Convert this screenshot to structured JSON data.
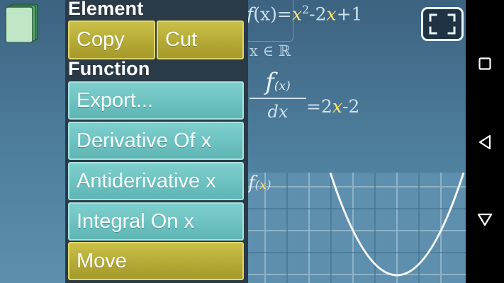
{
  "menu": {
    "element_header": "Element",
    "copy_label": "Copy",
    "cut_label": "Cut",
    "function_header": "Function",
    "export_label": "Export...",
    "derivative_label": "Derivative Of x",
    "antiderivative_label": "Antiderivative x",
    "integral_label": "Integral On x",
    "move_label": "Move"
  },
  "math": {
    "function_name": "f",
    "function_arg": "(x)",
    "equals": "=",
    "term_x": "x",
    "exponent": "2",
    "rest": "-2",
    "term_x2": "x",
    "constant": "+1",
    "domain": "x ∈ ℝ",
    "derivative_num": "f",
    "derivative_num_arg": "(x)",
    "derivative_den": "dx",
    "derivative_eq": "=2",
    "derivative_x": "x",
    "derivative_rest": "-2",
    "graph_label_f": "f",
    "graph_label_arg_open": "(",
    "graph_label_x": "x",
    "graph_label_arg_close": ")"
  },
  "icons": {
    "layers": "layers-icon",
    "fullscreen": "fullscreen-icon",
    "nav_recents": "square-icon",
    "nav_back": "back-triangle-icon",
    "nav_home": "home-triangle-icon"
  },
  "colors": {
    "yellow_button": "#b5aa36",
    "teal_button": "#6ec3c2",
    "menu_panel": "#2b3a47",
    "variable_highlight": "#ffe37a"
  }
}
